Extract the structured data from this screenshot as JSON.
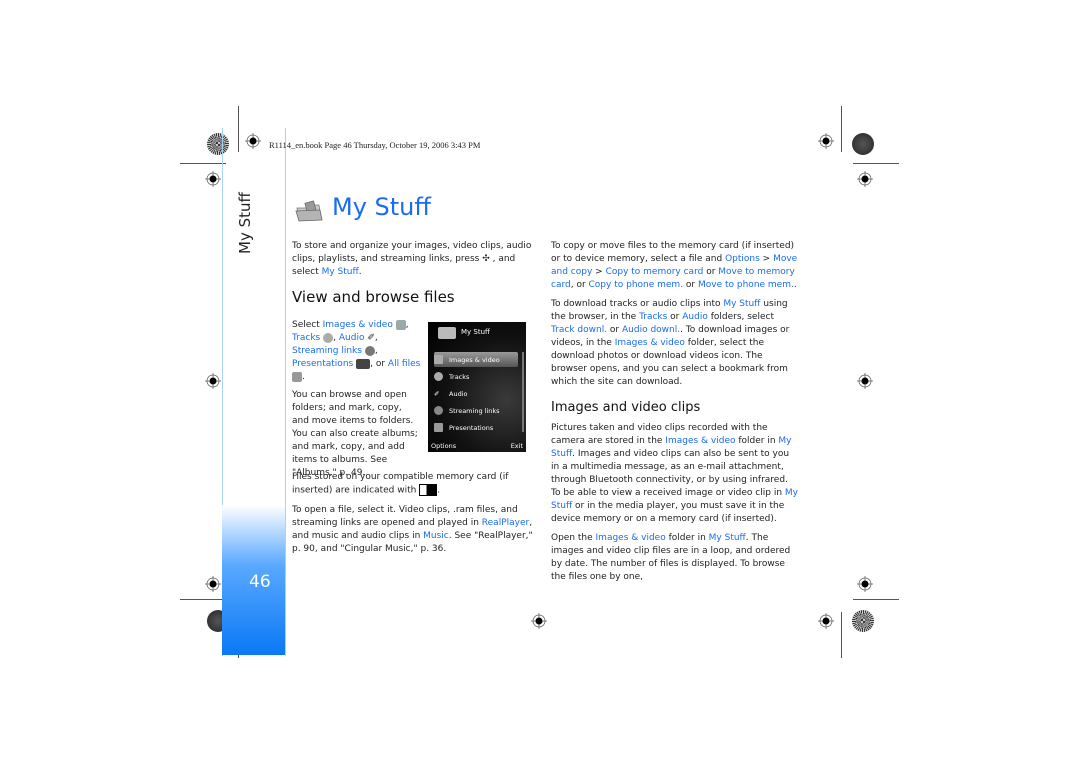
{
  "header": {
    "book_line": "R1114_en.book  Page 46  Thursday, October 19, 2006  3:43 PM"
  },
  "sidebar": {
    "section_title": "My Stuff",
    "page_number": "46",
    "accent_color": "#0a78f5"
  },
  "page": {
    "title": "My Stuff",
    "title_icon": "folder-icon",
    "link_color": "#1a6cf0"
  },
  "left_column": {
    "intro": {
      "text_a": "To store and organize your images, video clips, audio clips, playlists, and streaming links, press ",
      "key_icon": "menu-key-icon",
      "text_b": " , and select ",
      "link": "My Stuff",
      "text_c": "."
    },
    "section_heading": "View and browse files",
    "select_list": {
      "prefix": "Select ",
      "items": [
        {
          "label": "Images & video",
          "icon": "images-video-icon",
          "sep": ","
        },
        {
          "label": "Tracks",
          "icon": "tracks-icon",
          "sep": ","
        },
        {
          "label": "Audio",
          "icon": "audio-icon",
          "sep": ","
        },
        {
          "label": "Streaming links",
          "icon": "streaming-links-icon",
          "sep": ","
        },
        {
          "label": "Presentations",
          "icon": "presentations-icon",
          "sep": ", or"
        },
        {
          "label": "All files",
          "icon": "all-files-icon",
          "sep": "."
        }
      ]
    },
    "browse_text": "You can browse and open folders; and mark, copy, and move items to folders. You can also create albums; and mark, copy, and add items to albums. See \"Albums,\" p. 49.",
    "memory_card": {
      "text_a": "Files stored on your compatible memory card (if inserted) are indicated with ",
      "icon": "memory-card-icon",
      "text_b": "."
    },
    "open_file": {
      "text_a": "To open a file, select it. Video clips, .ram files, and streaming links are opened and played in ",
      "link_a": "RealPlayer",
      "text_b": ", and music and audio clips in ",
      "link_b": "Music",
      "text_c": ". See \"RealPlayer,\" p. 90, and \"Cingular Music,\" p. 36."
    }
  },
  "phone_screen": {
    "title": "My Stuff",
    "items": [
      "Images & video",
      "Tracks",
      "Audio",
      "Streaming links",
      "Presentations"
    ],
    "selected_index": 0,
    "left_softkey": "Options",
    "right_softkey": "Exit"
  },
  "right_column": {
    "copy_move": {
      "text_a": "To copy or move files to the memory card (if inserted) or to device memory, select a file and ",
      "link_a": "Options",
      "text_b": " > ",
      "link_b": "Move and copy",
      "text_c": " > ",
      "link_c": "Copy to memory card",
      "text_d": " or ",
      "link_d": "Move to memory card",
      "text_e": ", or ",
      "link_e": "Copy to phone mem.",
      "text_f": " or ",
      "link_f": "Move to phone mem.",
      "text_g": "."
    },
    "download": {
      "text_a": "To download tracks or audio clips into ",
      "link_a": "My Stuff",
      "text_b": " using the browser, in the ",
      "link_b": "Tracks",
      "text_c": " or ",
      "link_c": "Audio",
      "text_d": " folders, select ",
      "link_d": "Track downl.",
      "text_e": " or ",
      "link_e": "Audio downl.",
      "text_f": ". To download images or videos, in the ",
      "link_f": "Images & video",
      "text_g": " folder, select the download photos or download videos icon. The browser opens, and you can select a bookmark from which the site can download."
    },
    "section_heading": "Images and video clips",
    "pictures": {
      "text_a": "Pictures taken and video clips recorded with the camera are stored in the ",
      "link_a": "Images & video",
      "text_b": " folder in ",
      "link_b": "My Stuff",
      "text_c": ". Images and video clips can also be sent to you in a multimedia message, as an e-mail attachment,  through Bluetooth connectivity, or by using infrared. To be able to view a received image or video clip in ",
      "link_c": "My Stuff",
      "text_d": " or in the media player, you must save it in the device memory or on a memory card (if inserted)."
    },
    "open_folder": {
      "text_a": "Open the ",
      "link_a": "Images & video",
      "text_b": " folder in ",
      "link_b": "My Stuff",
      "text_c": ". The images and video clip files are in a loop, and ordered by date. The number of files is displayed. To browse the files one by one,"
    }
  }
}
